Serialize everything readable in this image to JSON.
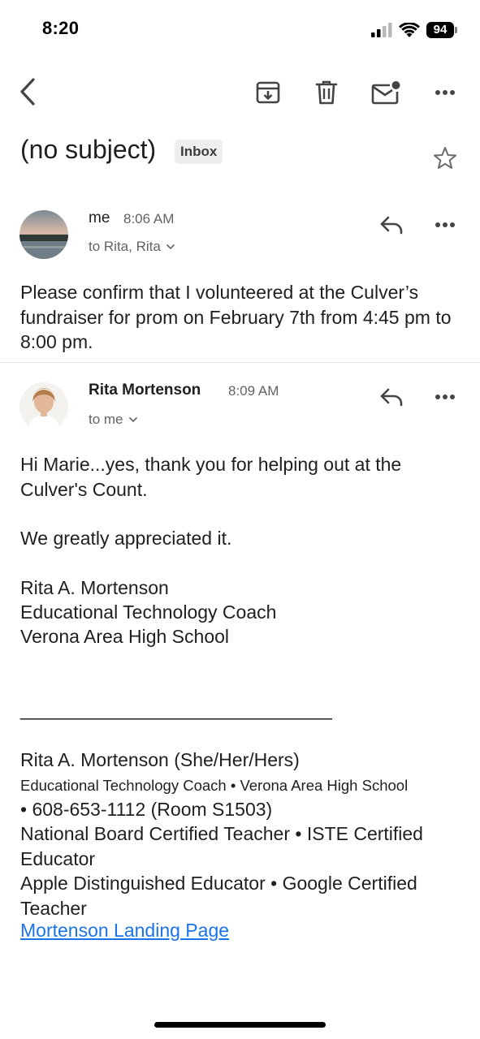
{
  "status_bar": {
    "time": "8:20",
    "battery": "94"
  },
  "toolbar": {
    "icons": [
      "back-icon",
      "archive-icon",
      "trash-icon",
      "mark-unread-icon",
      "more-icon"
    ]
  },
  "email": {
    "subject": "(no subject)",
    "label": "Inbox",
    "messages": [
      {
        "sender": "me",
        "time": "8:06 AM",
        "recipients": "to Rita, Rita",
        "body": "Please confirm that I volunteered at the Culver’s fundraiser for prom on February 7th from 4:45 pm to 8:00 pm."
      },
      {
        "sender": "Rita Mortenson",
        "time": "8:09 AM",
        "recipients": "to me",
        "body_lines": [
          "Hi Marie...yes, thank you for helping out at the Culver's Count.",
          "We greatly appreciated it.",
          "Rita A. Mortenson",
          "Educational Technology Coach",
          "Verona Area High School"
        ],
        "separator": "______________________________",
        "signature": {
          "name_line": "Rita A. Mortenson (She/Her/Hers)",
          "title_line": "Educational Technology Coach • Verona Area High School",
          "phone_line": "• 608-653-1112 (Room S1503)",
          "cert_line1": "National Board Certified Teacher • ISTE Certified Educator",
          "cert_line2": "Apple Distinguished Educator • Google Certified Teacher",
          "link_text": "Mortenson Landing Page"
        }
      }
    ]
  },
  "colors": {
    "accent": "#1a73e8",
    "secondary_text": "#5f6368",
    "chip_bg": "#eeeeee"
  }
}
